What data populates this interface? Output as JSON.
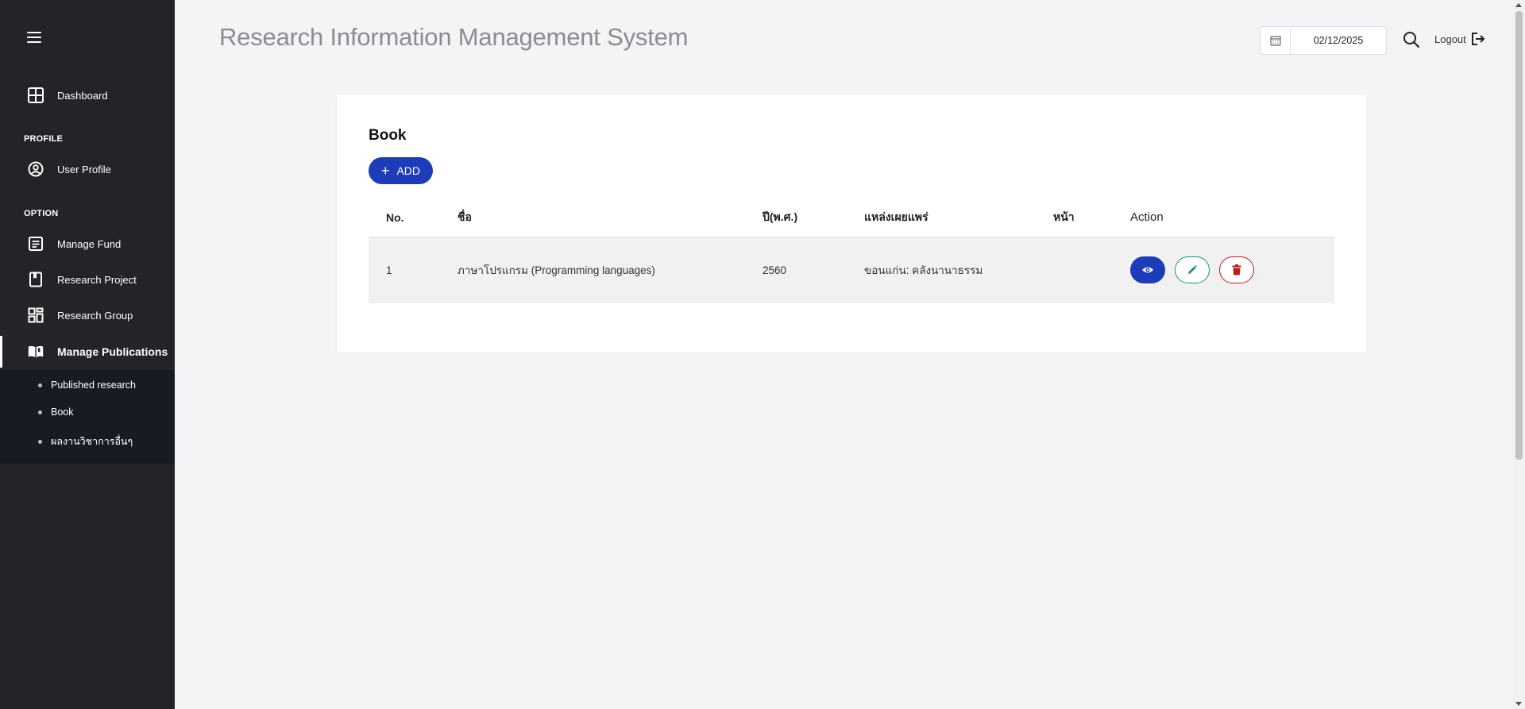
{
  "app": {
    "title": "Research Information Management System"
  },
  "sidebar": {
    "dashboard": "Dashboard",
    "section_profile": "PROFILE",
    "user_profile": "User Profile",
    "section_option": "OPTION",
    "manage_fund": "Manage Fund",
    "research_project": "Research Project",
    "research_group": "Research Group",
    "manage_publications": "Manage Publications",
    "submenu": [
      "Published research",
      "Book",
      "ผลงานวิชาการอื่นๆ"
    ]
  },
  "header": {
    "date": "02/12/2025",
    "logout": "Logout"
  },
  "page": {
    "title": "Book",
    "add_label": "ADD"
  },
  "table": {
    "headers": [
      "No.",
      "ชื่อ",
      "ปี(พ.ศ.)",
      "แหล่งเผยแพร่",
      "หน้า",
      "Action"
    ],
    "rows": [
      {
        "no": "1",
        "name": "ภาษาโปรแกรม (Programming languages)",
        "year": "2560",
        "source": "ขอนแก่น: คลังนานาธรรม",
        "pages": ""
      }
    ]
  },
  "colors": {
    "sidebar_bg": "#222427",
    "submenu_bg": "#171c24",
    "primary": "#1e3bb8",
    "edit": "#1d8f7f",
    "delete": "#b71c1c"
  }
}
